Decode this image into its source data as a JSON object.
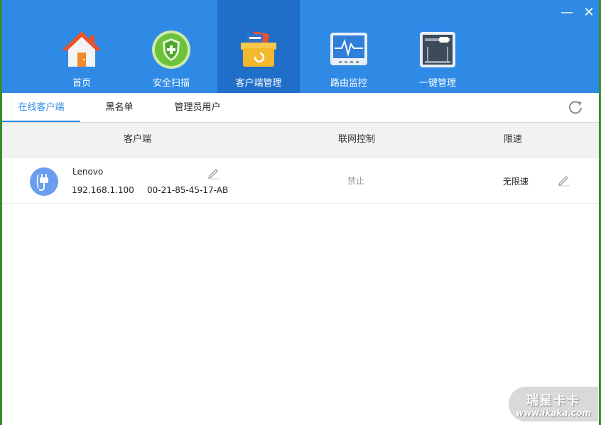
{
  "window": {
    "minimize_glyph": "—",
    "close_glyph": "✕"
  },
  "nav": [
    {
      "label": "首页",
      "icon": "home-icon"
    },
    {
      "label": "安全扫描",
      "icon": "shield-icon"
    },
    {
      "label": "客户端管理",
      "icon": "client-box-icon",
      "active": true
    },
    {
      "label": "路由监控",
      "icon": "monitor-icon"
    },
    {
      "label": "一键管理",
      "icon": "router-icon"
    }
  ],
  "tabs": [
    {
      "label": "在线客户端",
      "active": true
    },
    {
      "label": "黑名单"
    },
    {
      "label": "管理员用户"
    }
  ],
  "table": {
    "columns": [
      "客户端",
      "联网控制",
      "限速"
    ],
    "rows": [
      {
        "name": "Lenovo",
        "ip": "192.168.1.100",
        "mac": "00-21-85-45-17-AB",
        "network_control": "禁止",
        "speed_limit": "无限速"
      }
    ]
  },
  "colors": {
    "brand_blue": "#2f8ae6",
    "active_tab": "#1f6fc9"
  },
  "watermark": {
    "title": "瑞星卡卡",
    "url": "www.ikaka.com"
  }
}
